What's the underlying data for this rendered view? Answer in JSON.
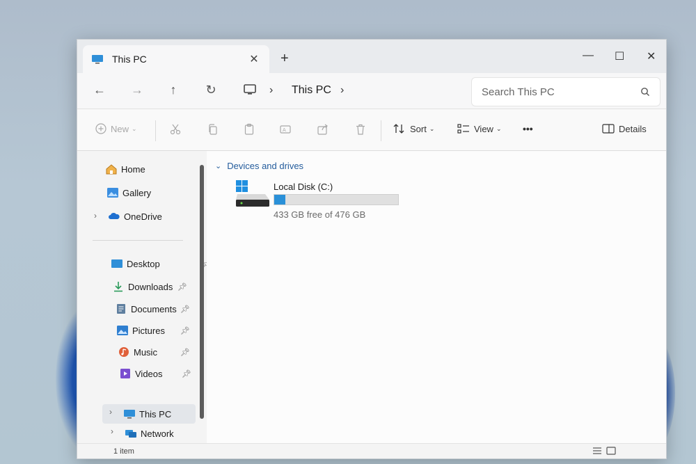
{
  "window": {
    "tab_title": "This PC",
    "new_tab": "+",
    "close_tab": "✕",
    "minimize": "—",
    "maximize": "☐",
    "close": "✕"
  },
  "nav": {
    "back": "←",
    "forward": "→",
    "up": "↑",
    "refresh": "↻",
    "breadcrumb": [
      "This PC"
    ],
    "separator": "›"
  },
  "search": {
    "placeholder": "Search This PC"
  },
  "toolbar": {
    "new_label": "New",
    "sort_label": "Sort",
    "view_label": "View",
    "more_label": "•••",
    "details_label": "Details"
  },
  "sidebar": {
    "home": "Home",
    "gallery": "Gallery",
    "onedrive": "OneDrive",
    "pinned": [
      "Desktop",
      "Downloads",
      "Documents",
      "Pictures",
      "Music",
      "Videos"
    ],
    "this_pc": "This PC",
    "network": "Network"
  },
  "content": {
    "group_header": "Devices and drives",
    "drives": [
      {
        "name": "Local Disk (C:)",
        "free_text": "433 GB free of 476 GB",
        "used_fraction": 0.09
      }
    ]
  },
  "status": {
    "item_count": "1 item"
  },
  "colors": {
    "accent": "#2a90d8",
    "link": "#245c9c"
  }
}
